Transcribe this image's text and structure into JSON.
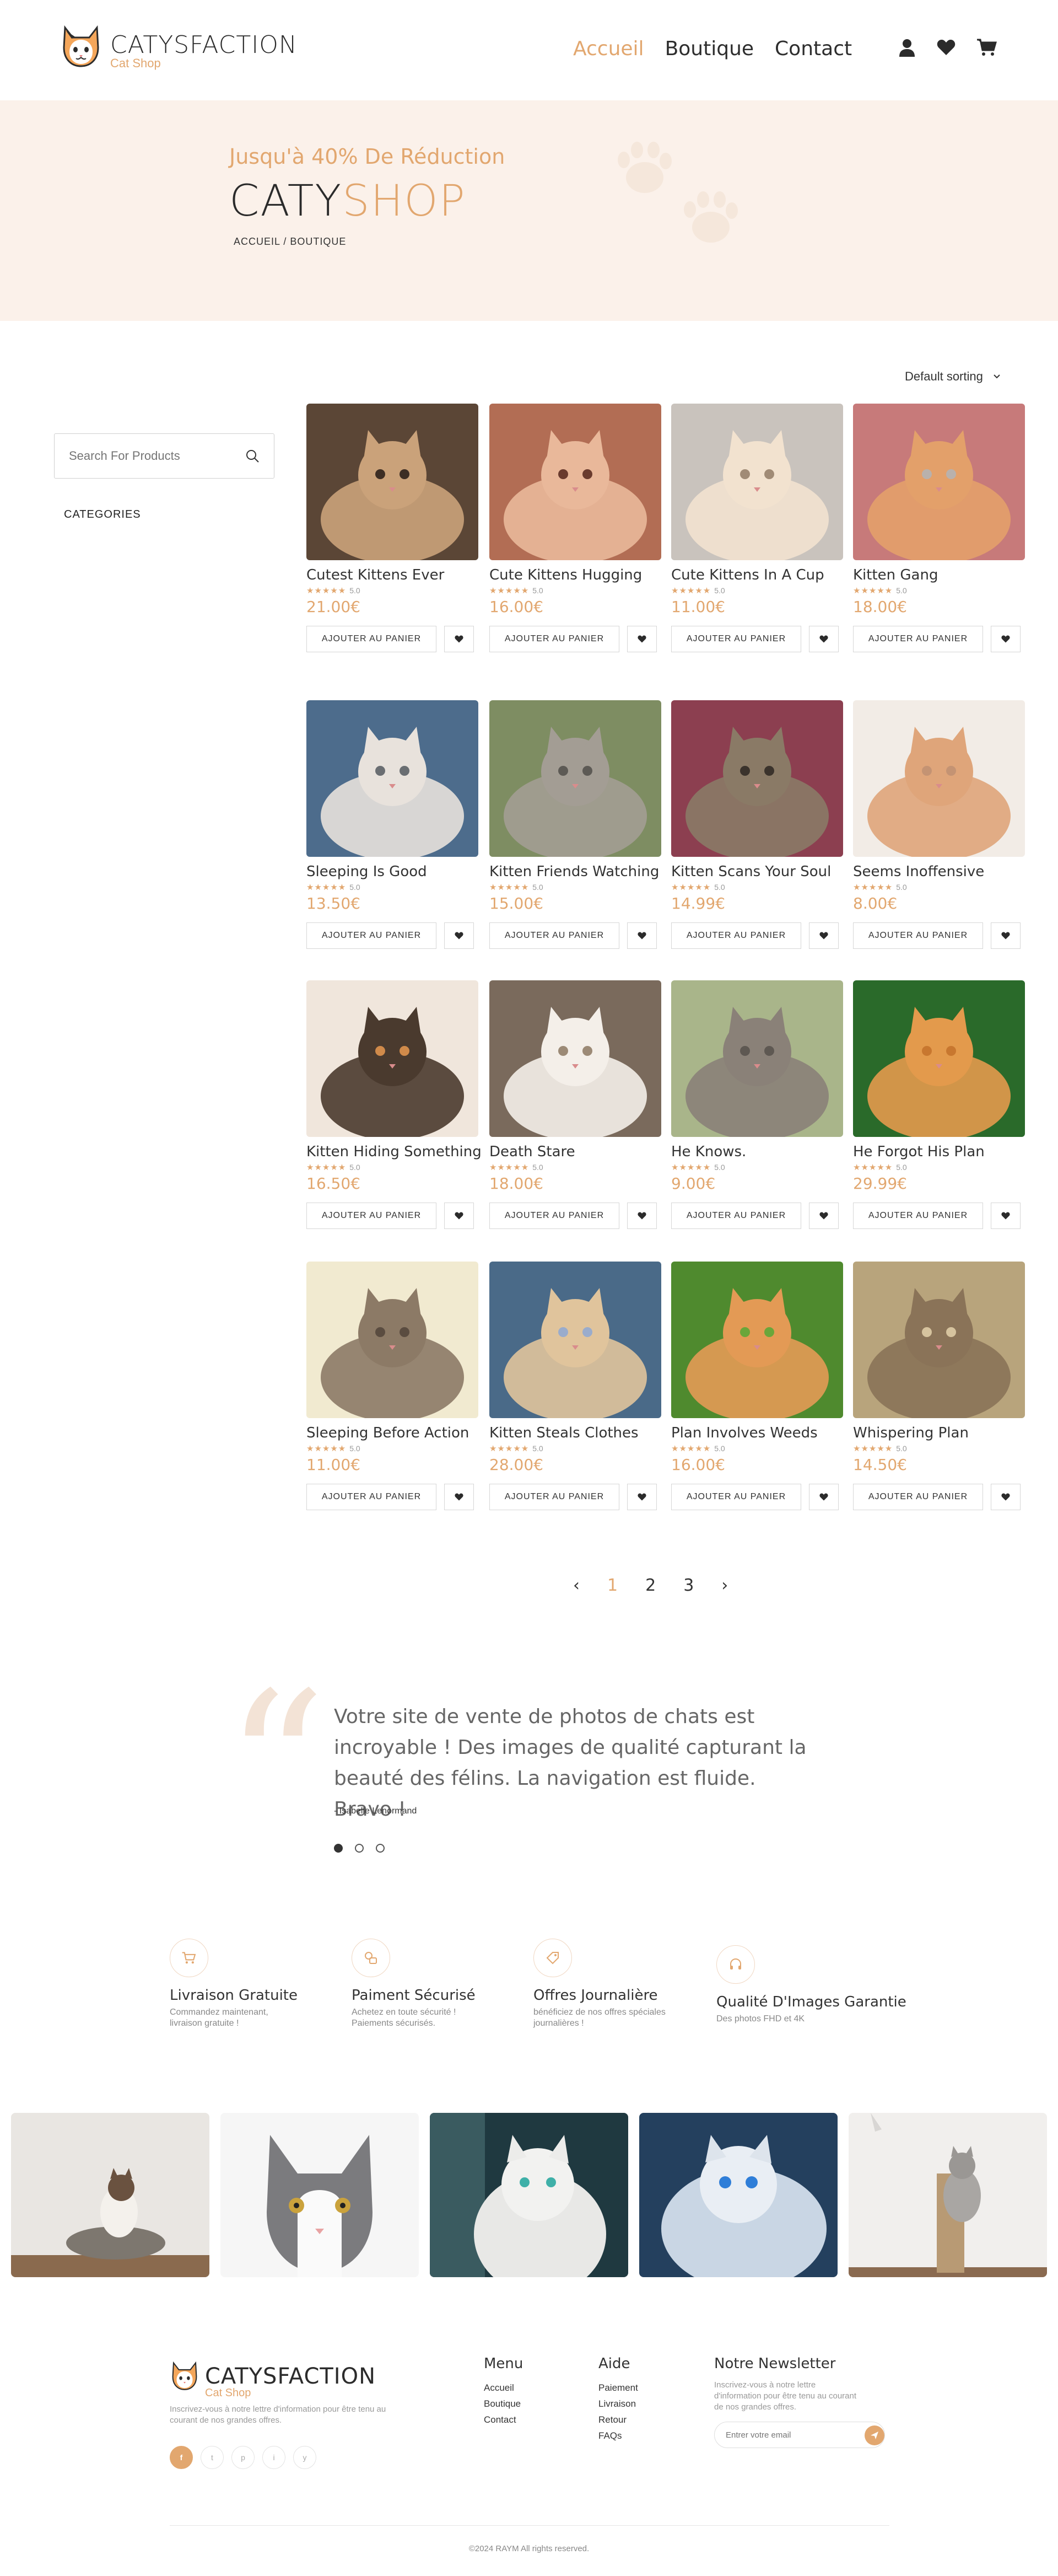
{
  "header": {
    "brand": "CATYSFACTION",
    "brand_sub": "Cat Shop",
    "nav": [
      "Accueil",
      "Boutique",
      "Contact"
    ],
    "nav_active": "Accueil",
    "icons": [
      "user-icon",
      "heart-icon",
      "cart-icon"
    ]
  },
  "hero": {
    "promo": "Jusqu'à 40% De Réduction",
    "title_a": "CATY",
    "title_b": "SHOP",
    "breadcrumb": "ACCUEIL / BOUTIQUE"
  },
  "shop": {
    "sorting": "Default sorting",
    "search_placeholder": "Search For Products",
    "categories_label": "CATEGORIES",
    "add_label": "AJOUTER AU PANIER",
    "rating": "5.0",
    "products": [
      {
        "name": "Cutest Kittens Ever",
        "price": "21.00€"
      },
      {
        "name": "Cute Kittens Hugging",
        "price": "16.00€"
      },
      {
        "name": "Cute Kittens In A Cup",
        "price": "11.00€"
      },
      {
        "name": "Kitten Gang",
        "price": "18.00€"
      },
      {
        "name": "Sleeping Is Good",
        "price": "13.50€"
      },
      {
        "name": "Kitten Friends Watching",
        "price": "15.00€"
      },
      {
        "name": "Kitten Scans Your Soul",
        "price": "14.99€"
      },
      {
        "name": "Seems Inoffensive",
        "price": "8.00€"
      },
      {
        "name": "Kitten Hiding Something",
        "price": "16.50€"
      },
      {
        "name": "Death  Stare",
        "price": "18.00€"
      },
      {
        "name": "He Knows.",
        "price": "9.00€"
      },
      {
        "name": "He Forgot His Plan",
        "price": "29.99€"
      },
      {
        "name": "Sleeping Before Action",
        "price": "11.00€"
      },
      {
        "name": "Kitten Steals Clothes",
        "price": "28.00€"
      },
      {
        "name": "Plan Involves Weeds",
        "price": "16.00€"
      },
      {
        "name": "Whispering Plan",
        "price": "14.50€"
      }
    ],
    "pagination": {
      "prev": "‹",
      "pages": [
        "1",
        "2",
        "3"
      ],
      "current": "1",
      "next": "›"
    }
  },
  "testimonial": {
    "quote": "Votre site de vente de photos de chats est incroyable ! Des images de qualité capturant la beauté des félins. La navigation est fluide. Bravo !",
    "author": "- Isabelle Lenormand"
  },
  "features": [
    {
      "icon": "cart-icon",
      "title": "Livraison Gratuite",
      "desc": "Commandez maintenant, livraison gratuite !"
    },
    {
      "icon": "payment-icon",
      "title": "Paiment Sécurisé",
      "desc": "Achetez en toute sécurité ! Paiements sécurisés."
    },
    {
      "icon": "tag-icon",
      "title": "Offres Journalière",
      "desc": "bénéficiez de nos offres spéciales journalières !"
    },
    {
      "icon": "headset-icon",
      "title": "Qualité D'Images Garantie",
      "desc": "Des photos FHD et 4K"
    }
  ],
  "footer": {
    "brand": "CATYSFACTION",
    "brand_sub": "Cat Shop",
    "text": "Inscrivez-vous à notre lettre d'information pour être tenu au courant de nos grandes offres.",
    "socials": [
      "f",
      "t",
      "p",
      "i",
      "y"
    ],
    "menu_title": "Menu",
    "menu": [
      "Accueil",
      "Boutique",
      "Contact"
    ],
    "aide_title": "Aide",
    "aide": [
      "Paiement",
      "Livraison",
      "Retour",
      "FAQs"
    ],
    "newsletter_title": "Notre Newsletter",
    "newsletter_text": "Inscrivez-vous à notre lettre d'information pour être tenu au courant de nos grandes offres.",
    "email_placeholder": "Entrer votre email",
    "copyright": "©2024 RAYM All rights reserved."
  },
  "colors": {
    "accent": "#e2a76f",
    "hero_bg": "#fbf1ea",
    "text": "#333333"
  }
}
